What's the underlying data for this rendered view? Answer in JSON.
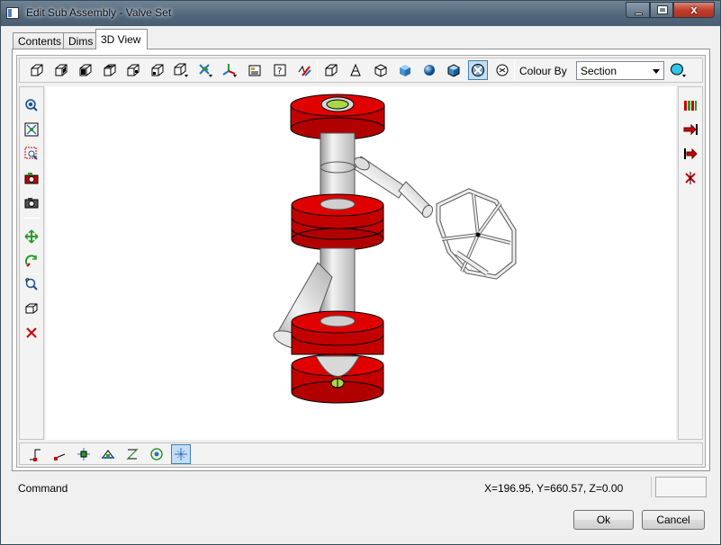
{
  "window": {
    "title": "Edit Sub Assembly - Valve Set",
    "close_glyph": "x"
  },
  "tabs": [
    {
      "label": "Contents",
      "active": false
    },
    {
      "label": "Dims",
      "active": false
    },
    {
      "label": "3D View",
      "active": true
    }
  ],
  "toolbar_top": {
    "icons": [
      "view-iso-1-icon",
      "view-iso-2-icon",
      "view-iso-3-icon",
      "view-iso-4-icon",
      "view-iso-5-icon",
      "view-iso-6-icon",
      "view-iso-7-icon",
      "axis-rotate-icon",
      "axis-xyz-icon",
      "properties-icon",
      "help-icon",
      "edit-style-icon"
    ],
    "render_icons": [
      "wireframe-icon",
      "hidden-line-icon",
      "outline-icon",
      "flat-shaded-icon",
      "smooth-shaded-icon",
      "solid-shaded-icon",
      "section-shaded-icon",
      "perspective-icon"
    ],
    "colour_by_label": "Colour By",
    "colour_by_value": "Section",
    "colour_swatch": "#2ec4e8"
  },
  "toolbar_left": {
    "icons": [
      "zoom-all-icon",
      "zoom-extents-icon",
      "zoom-window-icon",
      "camera-save-icon",
      "camera-icon",
      "pan-icon",
      "rotate-icon",
      "zoom-icon",
      "box-view-icon",
      "delete-icon"
    ]
  },
  "toolbar_right": {
    "icons": [
      "columns-icon",
      "arrow-right-red-icon",
      "arrow-left-red-icon",
      "delete-red-icon"
    ]
  },
  "toolbar_bottom": {
    "icons": [
      "snap-end-icon",
      "snap-mid-icon",
      "snap-node-icon",
      "snap-center-icon",
      "snap-perp-icon",
      "snap-circle-icon",
      "snap-grid-icon"
    ],
    "selected_index": 6
  },
  "status": {
    "command_label": "Command",
    "coords": "X=196.95, Y=660.57, Z=0.00"
  },
  "buttons": {
    "ok": "Ok",
    "cancel": "Cancel"
  },
  "colors": {
    "flange": "#cc0000",
    "pipe": "#d8d8d8",
    "bore": "#a8d84a"
  }
}
